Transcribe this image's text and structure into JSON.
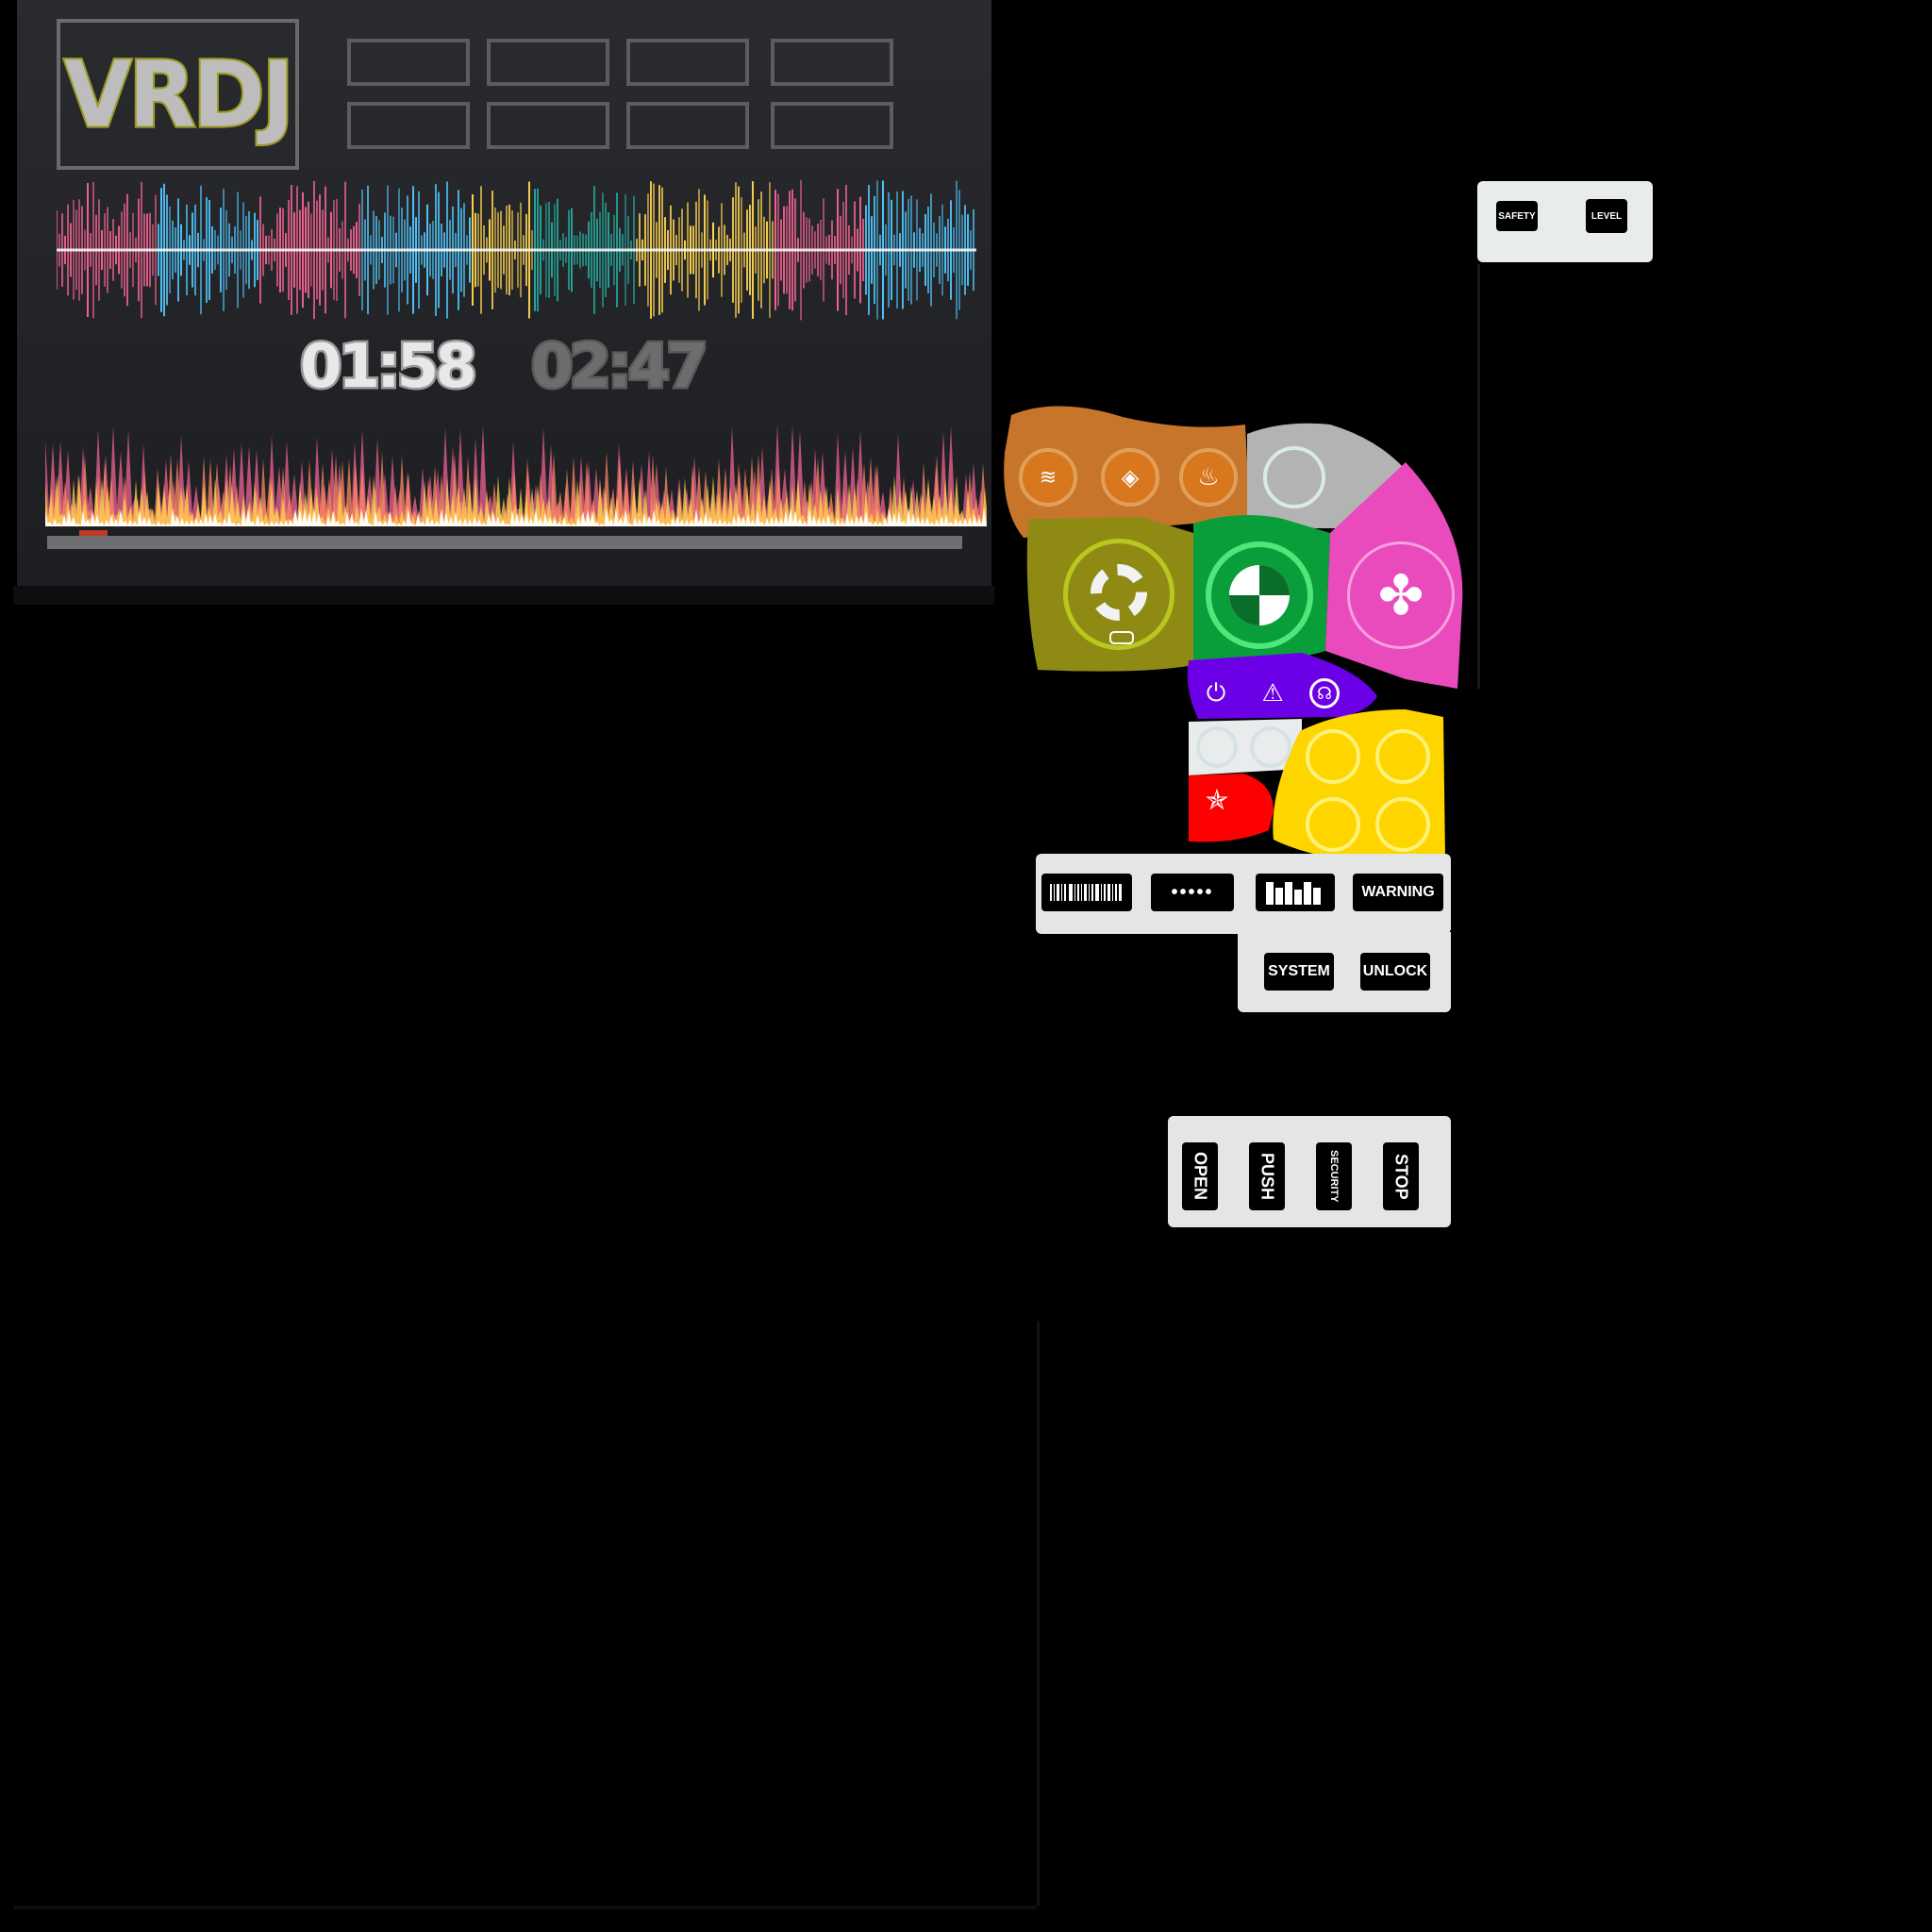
{
  "deck": {
    "logo": "VRDJ",
    "time_elapsed": "01:58",
    "time_total": "02:47",
    "playback_progress": 0.03,
    "pads_count_label": "",
    "pads": [
      "",
      "",
      "",
      "",
      "",
      "",
      "",
      ""
    ],
    "colors": {
      "panel": "#242528",
      "logo_outline": "#9c9a23",
      "wave_pink": "#f06292",
      "wave_blue": "#4fc3f7",
      "wave_yellow": "#ffd54f",
      "wave_green": "#26a69a"
    }
  },
  "top_strip": {
    "safety_label": "SAFETY",
    "level_label": "LEVEL"
  },
  "panel": {
    "orange_icons": [
      "heat-bars-icon",
      "eye-icon",
      "heat-waves-icon"
    ],
    "big_buttons": [
      {
        "name": "lifebuoy-button",
        "icon": "lifebuoy-icon",
        "color": "#8f8a14"
      },
      {
        "name": "target-button",
        "icon": "quadrant-target-icon",
        "color": "#0a9e3a"
      },
      {
        "name": "clover-button",
        "icon": "clover-icon",
        "color": "#e94bbd"
      }
    ],
    "purple_icons": [
      "power-icon",
      "warning-signal-icon",
      "headset-icon"
    ],
    "red_icon": "star-icon",
    "colors": {
      "orange": "#c8752c",
      "grey": "#b3b3b3",
      "olive": "#8f8a14",
      "green": "#0a9e3a",
      "pink": "#e94bbd",
      "purple": "#6b00e6",
      "yellow": "#ffd500",
      "red": "#ff0000"
    }
  },
  "label_row": {
    "barcode_icon": "barcode-icon",
    "dots_icon": "dots-icon",
    "bars_icon": "equalizer-blocks-icon",
    "warning_label": "WARNING",
    "system_label": "SYSTEM",
    "unlock_label": "UNLOCK"
  },
  "vertical_row": {
    "labels": [
      "OPEN",
      "PUSH",
      "SECURITY",
      "STOP"
    ]
  }
}
